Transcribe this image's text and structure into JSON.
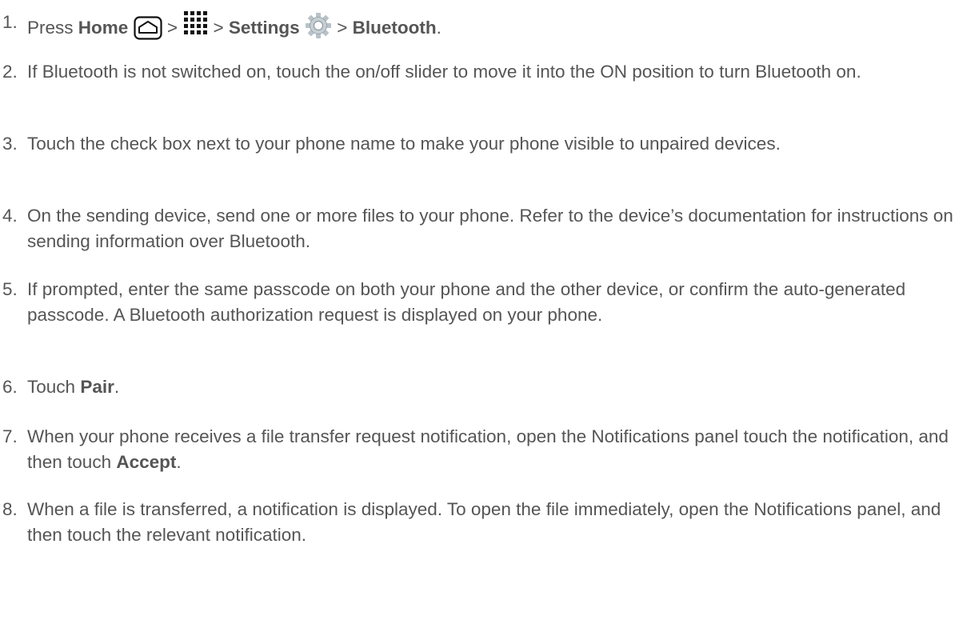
{
  "steps": [
    {
      "num": "1.",
      "parts": {
        "press": "Press",
        "home": "Home",
        "gt1": ">",
        "gt2": ">",
        "settings": "Settings",
        "gt3": ">",
        "bluetooth": "Bluetooth",
        "end": "."
      }
    },
    {
      "num": "2.",
      "text": "If Bluetooth is not switched on, touch the on/off slider to move it into the ON position to turn Bluetooth on."
    },
    {
      "num": "3.",
      "text": "Touch the check box next to your phone name to make your phone visible to unpaired devices."
    },
    {
      "num": "4.",
      "text": "On the sending device, send one or more files to your phone. Refer to the device’s documentation for instructions on sending information over Bluetooth."
    },
    {
      "num": "5.",
      "text": "If prompted, enter the same passcode on both your phone and the other device, or confirm the auto-generated passcode. A Bluetooth authorization request is displayed on your phone."
    },
    {
      "num": "6.",
      "parts": {
        "before": "Touch",
        "bold": "Pair",
        "after": "."
      }
    },
    {
      "num": "7.",
      "parts": {
        "before": "When your phone receives a file transfer request notification, open the Notifications panel touch the notification, and then touch",
        "bold": "Accept",
        "after": "."
      }
    },
    {
      "num": "8.",
      "text": "When a file is transferred, a notification is displayed. To open the file immediately, open the Notifications panel, and then touch the relevant notification."
    }
  ],
  "icons": {
    "home": "home-key-icon",
    "apps": "apps-grid-icon",
    "settings": "settings-gear-icon"
  }
}
